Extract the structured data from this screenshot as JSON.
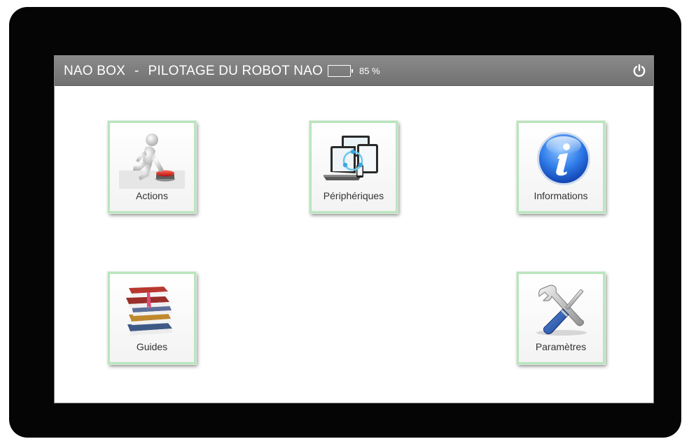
{
  "header": {
    "app_name": "NAO BOX",
    "separator": "-",
    "subtitle": "PILOTAGE DU ROBOT NAO",
    "battery_level": "85 %",
    "battery_fraction": 0.85,
    "power_icon": "power-icon"
  },
  "tiles": {
    "actions": {
      "label": "Actions",
      "icon": "push-button-figure-icon"
    },
    "peripheriques": {
      "label": "Périphériques",
      "icon": "devices-icon"
    },
    "informations": {
      "label": "Informations",
      "icon": "info-icon"
    },
    "guides": {
      "label": "Guides",
      "icon": "books-icon"
    },
    "parametres": {
      "label": "Paramètres",
      "icon": "tools-icon"
    }
  },
  "colors": {
    "bezel": "#050505",
    "header_bar": "#7b7b7b",
    "tile_border": "#b9e6bd"
  }
}
